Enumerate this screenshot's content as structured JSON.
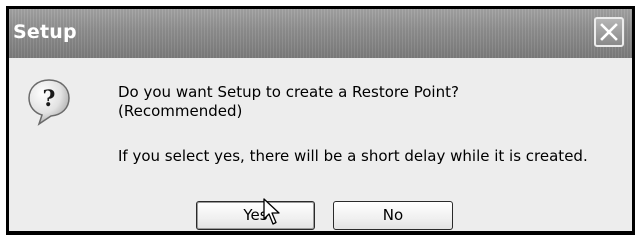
{
  "window": {
    "title": "Setup",
    "close_icon": "close-icon"
  },
  "dialog": {
    "icon": "question-icon",
    "message_line1": "Do you want Setup to create a Restore Point?",
    "message_line2": "(Recommended)",
    "message_line3": "If you select yes, there will be a short delay while it is created."
  },
  "buttons": {
    "yes_label": "Yes",
    "no_label": "No"
  },
  "pointer": "mouse-pointer-icon"
}
